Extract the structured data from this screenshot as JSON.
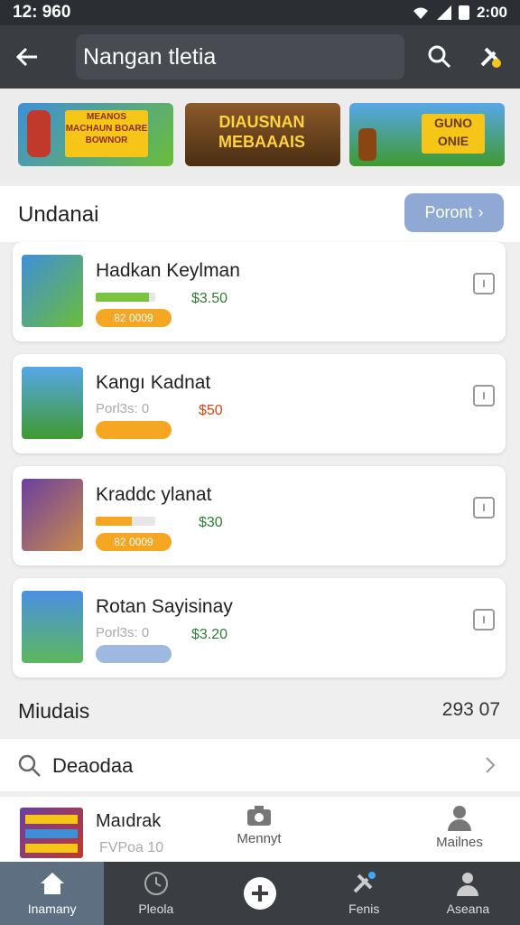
{
  "status": {
    "time": "12: 960",
    "right_text": "2:00"
  },
  "app_bar": {
    "title": "Nangan tletia",
    "back_icon": "back-arrow-icon",
    "search_icon": "search-icon",
    "tool_icon": "tools-icon"
  },
  "banners": [
    {
      "text": "MEANOS MACHAUN BOARE BOWNOR",
      "icon": "game-character-banner"
    },
    {
      "text": "DIAUSNAN MEBAAAIS",
      "icon": "title-banner"
    },
    {
      "text": "GUNO ONIE",
      "icon": "battle-banner"
    }
  ],
  "section": {
    "title": "Undanai",
    "button_label": "Poront",
    "button_chevron": "›"
  },
  "games": [
    {
      "title": "Hadkan Keylman",
      "price": "$3.50",
      "price_color": "#2e7d32",
      "progress": 0.9,
      "progress_color": "#7cc242",
      "badge": "82 0009",
      "badge_color": "#f5a623",
      "sub": ""
    },
    {
      "title": "Kangı Kadnat",
      "price": "$50",
      "price_color": "#d84315",
      "progress": null,
      "progress_color": "",
      "badge": "",
      "badge_color": "#f5a623",
      "sub": "Porl3s: 0"
    },
    {
      "title": "Kraddc ylanat",
      "price": "$30",
      "price_color": "#2e7d32",
      "progress": 0.6,
      "progress_color": "#f5a623",
      "badge": "82 0009",
      "badge_color": "#f5a623",
      "sub": ""
    },
    {
      "title": "Rotan Sayisinay",
      "price": "$3.20",
      "price_color": "#2e7d32",
      "progress": null,
      "progress_color": "",
      "badge": "",
      "badge_color": "#9eb9e0",
      "sub": "Porl3s: 0"
    }
  ],
  "section2": {
    "label": "Miudais",
    "count": "293 07"
  },
  "search": {
    "label": "Deaodaa"
  },
  "shortcuts": {
    "title": "Maıdrak",
    "sub": "FVPoa 10",
    "col1_label": "Mennyt",
    "col2_label": "Mailnes"
  },
  "nav": [
    {
      "label": "Inamany",
      "icon": "home-icon"
    },
    {
      "label": "Pleola",
      "icon": "clock-icon"
    },
    {
      "label": "",
      "icon": "add-icon"
    },
    {
      "label": "Fenis",
      "icon": "tools-icon"
    },
    {
      "label": "Aseana",
      "icon": "profile-icon"
    }
  ]
}
